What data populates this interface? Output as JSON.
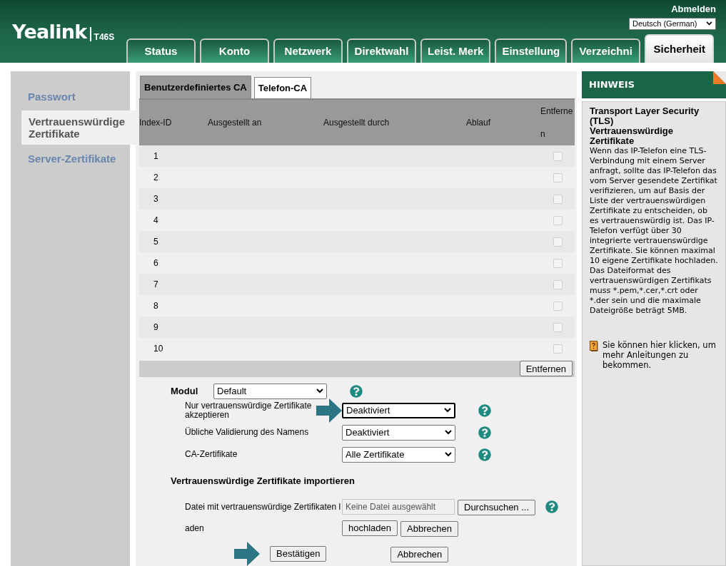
{
  "header": {
    "logo": "Yealink",
    "model": "T46S",
    "logout": "Abmelden",
    "language": "Deutsch (German)"
  },
  "tabs": [
    {
      "label": "Status",
      "selected": false
    },
    {
      "label": "Konto",
      "selected": false
    },
    {
      "label": "Netzwerk",
      "selected": false
    },
    {
      "label": "Direktwahl",
      "selected": false
    },
    {
      "label": "Leist. Merk",
      "selected": false
    },
    {
      "label": "Einstellung",
      "selected": false
    },
    {
      "label": "Verzeichni",
      "selected": false
    },
    {
      "label": "Sicherheit",
      "selected": true
    }
  ],
  "sidebar": {
    "items": [
      {
        "label": "Passwort",
        "selected": false
      },
      {
        "label": "Vertrauenswürdige Zertifikate",
        "selected": true
      },
      {
        "label": "Server-Zertifikate",
        "selected": false
      }
    ]
  },
  "subtabs": [
    {
      "label": "Benutzerdefiniertes CA",
      "selected": true
    },
    {
      "label": "Telefon-CA",
      "selected": false
    }
  ],
  "table": {
    "columns": [
      "Index-ID",
      "Ausgestellt an",
      "Ausgestellt durch",
      "Ablauf",
      "Entfernen"
    ],
    "rows": [
      {
        "index": "1",
        "checked": false,
        "disabled": true
      },
      {
        "index": "2",
        "checked": false,
        "disabled": true
      },
      {
        "index": "3",
        "checked": false,
        "disabled": true
      },
      {
        "index": "4",
        "checked": false,
        "disabled": true
      },
      {
        "index": "5",
        "checked": false,
        "disabled": true
      },
      {
        "index": "6",
        "checked": false,
        "disabled": true
      },
      {
        "index": "7",
        "checked": false,
        "disabled": true
      },
      {
        "index": "8",
        "checked": false,
        "disabled": true
      },
      {
        "index": "9",
        "checked": false,
        "disabled": true
      },
      {
        "index": "10",
        "checked": false,
        "disabled": true
      }
    ],
    "remove_button": "Entfernen"
  },
  "form": {
    "module": {
      "label": "Modul",
      "value": "Default"
    },
    "settings": [
      {
        "label": "Nur vertrauenswürdige Zertifikate akzeptieren",
        "value": "Deaktiviert",
        "focused": true,
        "pointer": true
      },
      {
        "label": "Übliche Validierung des Namens",
        "value": "Deaktiviert",
        "focused": false,
        "pointer": false
      },
      {
        "label": "CA-Zertifikate",
        "value": "Alle Zertifikate",
        "focused": false,
        "pointer": false
      }
    ],
    "import": {
      "title": "Vertrauenswürdige Zertifikate importieren",
      "file_label": "Datei mit vertrauenswürdige Zertifikaten l",
      "file_label_rest": "aden",
      "file_placeholder": "Keine Datei ausgewählt",
      "browse": "Durchsuchen ...",
      "upload": "hochladen",
      "cancel": "Abbrechen"
    },
    "actions": {
      "confirm": "Bestätigen",
      "confirm_pointer": true,
      "cancel": "Abbrechen"
    }
  },
  "hint": {
    "title": "HINWEIS",
    "headings": [
      "Transport Layer Security (TLS)",
      "Vertrauenswürdige Zertifikate"
    ],
    "body": "Wenn das IP-Telefon eine TLS-Verbindung mit einem Server anfragt, sollte das IP-Telefon das vom Server gesendete Zertifikat verifizieren, um auf Basis der Liste der vertrauenswürdigen Zertifikate zu entscheiden, ob es vertrauenswürdig ist. Das IP-Telefon verfügt über 30 integrierte vertrauenswürdige Zertifikate. Sie können maximal 10 eigene Zertifikate hochladen. Das Dateiformat des vertrauenswürdigen Zertifikats muss *.pem,*.cer,*.crt oder *.der sein und die maximale Dateigröße beträgt 5MB.",
    "help": "Sie können hier klicken, um mehr Anleitungen zu bekommen."
  }
}
